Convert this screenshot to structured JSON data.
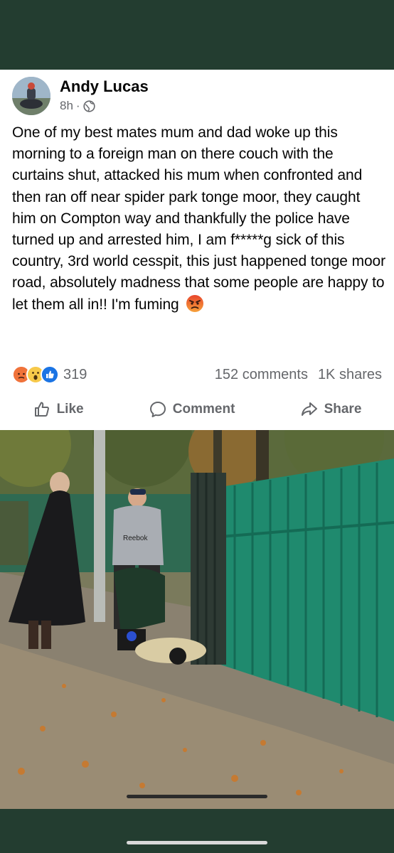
{
  "post": {
    "author": "Andy Lucas",
    "time": "8h",
    "separator": "·",
    "privacy_icon": "globe-icon",
    "text": "One of my best mates mum and dad woke up this morning to a foreign man on there couch with the curtains shut, attacked his mum when confronted and then ran off near spider park tonge moor, they caught him on Compton way and thankfully the police have turned up and arrested him, I am f*****g sick of this country, 3rd world cesspit, this just happened tonge moor road, absolutely madness that some people are happy to let them all in!! I'm fuming",
    "emoji": "angry-face-emoji"
  },
  "stats": {
    "reaction_icons": [
      "angry-react-icon",
      "wow-react-icon",
      "like-react-icon"
    ],
    "reaction_count": "319",
    "comments": "152 comments",
    "shares": "1K shares"
  },
  "actions": {
    "like": "Like",
    "comment": "Comment",
    "share": "Share"
  },
  "photo": {
    "description_icon": "street-photo-image",
    "shirt_text": "Reebok"
  },
  "colors": {
    "frame": "#233d30",
    "text": "#050505",
    "muted": "#65676b",
    "fence": "#1f8a6e"
  }
}
